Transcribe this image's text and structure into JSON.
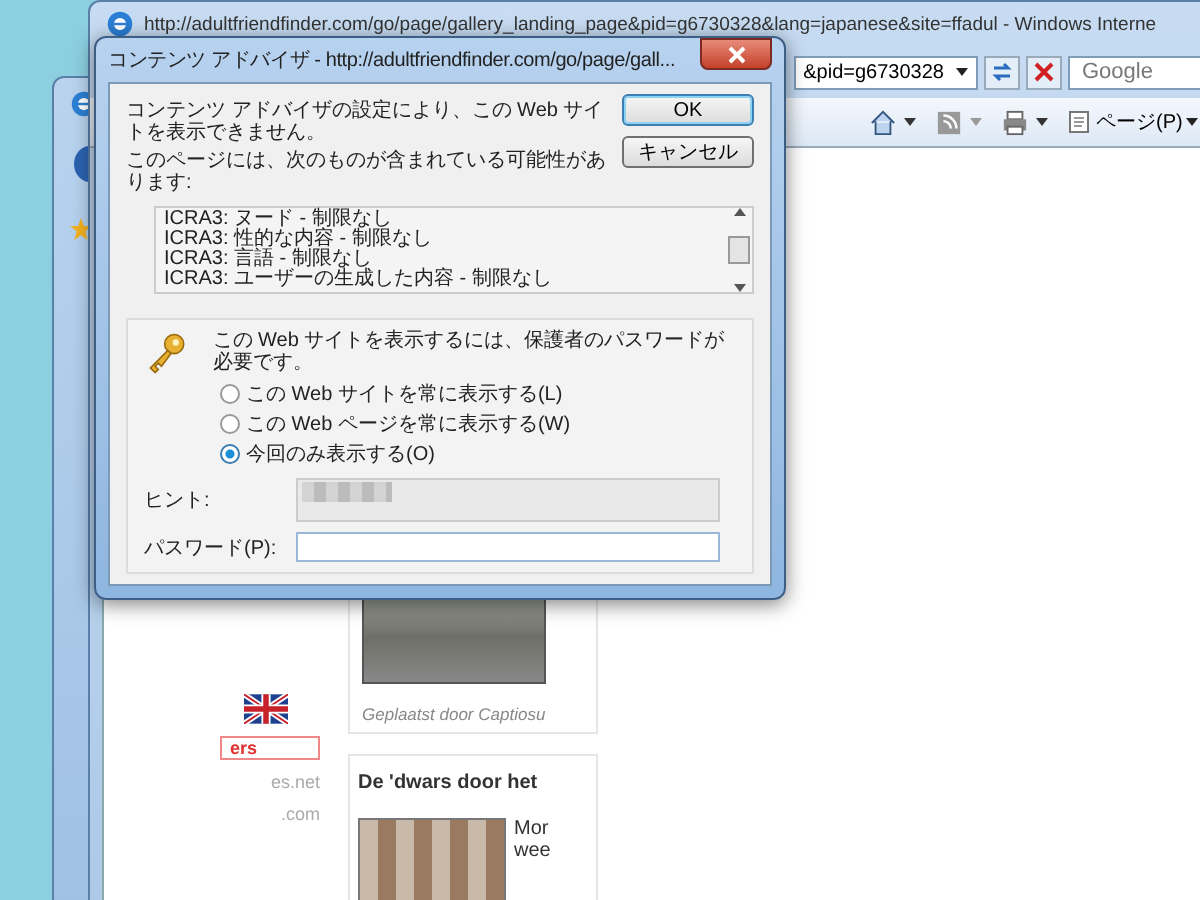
{
  "browser": {
    "title": "http://adultfriendfinder.com/go/page/gallery_landing_page&pid=g6730328&lang=japanese&site=ffadul - Windows Interne",
    "address": "&pid=g6730328",
    "search_placeholder": "Google",
    "page_menu": "ページ(P)"
  },
  "dialog": {
    "title": "コンテンツ アドバイザ - http://adultfriendfinder.com/go/page/gall...",
    "message": "コンテンツ アドバイザの設定により、この Web サイトを表示できません。",
    "list_label": "このページには、次のものが含まれている可能性があります:",
    "ratings": [
      "ICRA3: ヌード - 制限なし",
      "ICRA3: 性的な内容 - 制限なし",
      "ICRA3: 言語 - 制限なし",
      "ICRA3: ユーザーの生成した内容 - 制限なし"
    ],
    "buttons": [
      {
        "label": "OK",
        "default": true
      },
      {
        "label": "キャンセル",
        "default": false
      }
    ],
    "password_prompt": "この Web サイトを表示するには、保護者のパスワードが必要です。",
    "options": [
      {
        "label": "この Web サイトを常に表示する(L)",
        "selected": false
      },
      {
        "label": "この Web ページを常に表示する(W)",
        "selected": false
      },
      {
        "label": "今回のみ表示する(O)",
        "selected": true
      }
    ],
    "hint_label": "ヒント:",
    "password_label": "パスワード(P):"
  },
  "page": {
    "left_links": [
      {
        "text": "ers",
        "highlighted": true
      },
      {
        "text": "es.net",
        "highlighted": false
      },
      {
        "text": ".com",
        "highlighted": false
      }
    ],
    "caption": "Geplaatst door Captiosu",
    "heading": "De 'dwars door het",
    "snippet": [
      "Mor",
      "wee"
    ]
  }
}
